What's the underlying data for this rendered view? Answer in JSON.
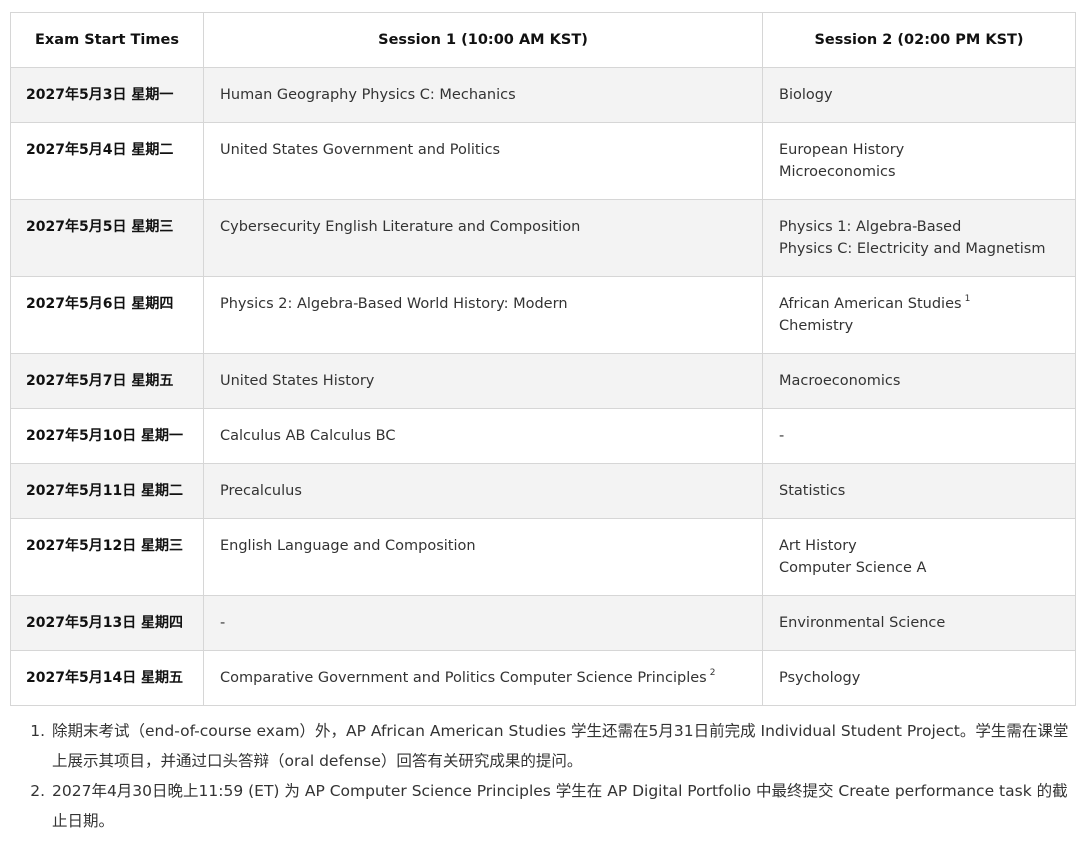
{
  "table": {
    "headers": [
      "Exam Start Times",
      "Session 1 (10:00 AM KST)",
      "Session 2 (02:00 PM KST)"
    ],
    "rows": [
      {
        "date": "2027年5月3日 星期一",
        "s1": [
          "Human Geography Physics C: Mechanics"
        ],
        "s1_sup": "",
        "s2": [
          "Biology"
        ],
        "s2_sup": ""
      },
      {
        "date": "2027年5月4日 星期二",
        "s1": [
          "United States Government and Politics"
        ],
        "s1_sup": "",
        "s2": [
          "European History",
          "Microeconomics"
        ],
        "s2_sup": ""
      },
      {
        "date": "2027年5月5日 星期三",
        "s1": [
          "Cybersecurity English Literature and Composition"
        ],
        "s1_sup": "",
        "s2": [
          "Physics 1: Algebra-Based",
          "Physics C: Electricity and Magnetism"
        ],
        "s2_sup": ""
      },
      {
        "date": "2027年5月6日 星期四",
        "s1": [
          "Physics 2: Algebra-Based World History: Modern"
        ],
        "s1_sup": "",
        "s2": [
          "African American Studies",
          "Chemistry"
        ],
        "s2_sup": "1"
      },
      {
        "date": "2027年5月7日 星期五",
        "s1": [
          "United States History"
        ],
        "s1_sup": "",
        "s2": [
          "Macroeconomics"
        ],
        "s2_sup": ""
      },
      {
        "date": "2027年5月10日 星期一",
        "s1": [
          "Calculus AB Calculus BC"
        ],
        "s1_sup": "",
        "s2": [
          "-"
        ],
        "s2_sup": ""
      },
      {
        "date": "2027年5月11日 星期二",
        "s1": [
          "Precalculus"
        ],
        "s1_sup": "",
        "s2": [
          "Statistics"
        ],
        "s2_sup": ""
      },
      {
        "date": "2027年5月12日 星期三",
        "s1": [
          "English Language and Composition"
        ],
        "s1_sup": "",
        "s2": [
          "Art History",
          "Computer Science A"
        ],
        "s2_sup": ""
      },
      {
        "date": "2027年5月13日 星期四",
        "s1": [
          "-"
        ],
        "s1_sup": "",
        "s2": [
          "Environmental Science"
        ],
        "s2_sup": ""
      },
      {
        "date": "2027年5月14日 星期五",
        "s1": [
          "Comparative Government and Politics Computer Science Principles"
        ],
        "s1_sup": "2",
        "s2": [
          "Psychology"
        ],
        "s2_sup": ""
      }
    ]
  },
  "footnotes": [
    "除期末考试（end-of-course exam）外，AP African American Studies 学生还需在5月31日前完成 Individual Student Project。学生需在课堂上展示其项目，并通过口头答辩（oral defense）回答有关研究成果的提问。",
    "2027年4月30日晚上11:59 (ET) 为 AP Computer Science Principles 学生在 AP Digital Portfolio 中最终提交 Create performance task 的截止日期。"
  ]
}
